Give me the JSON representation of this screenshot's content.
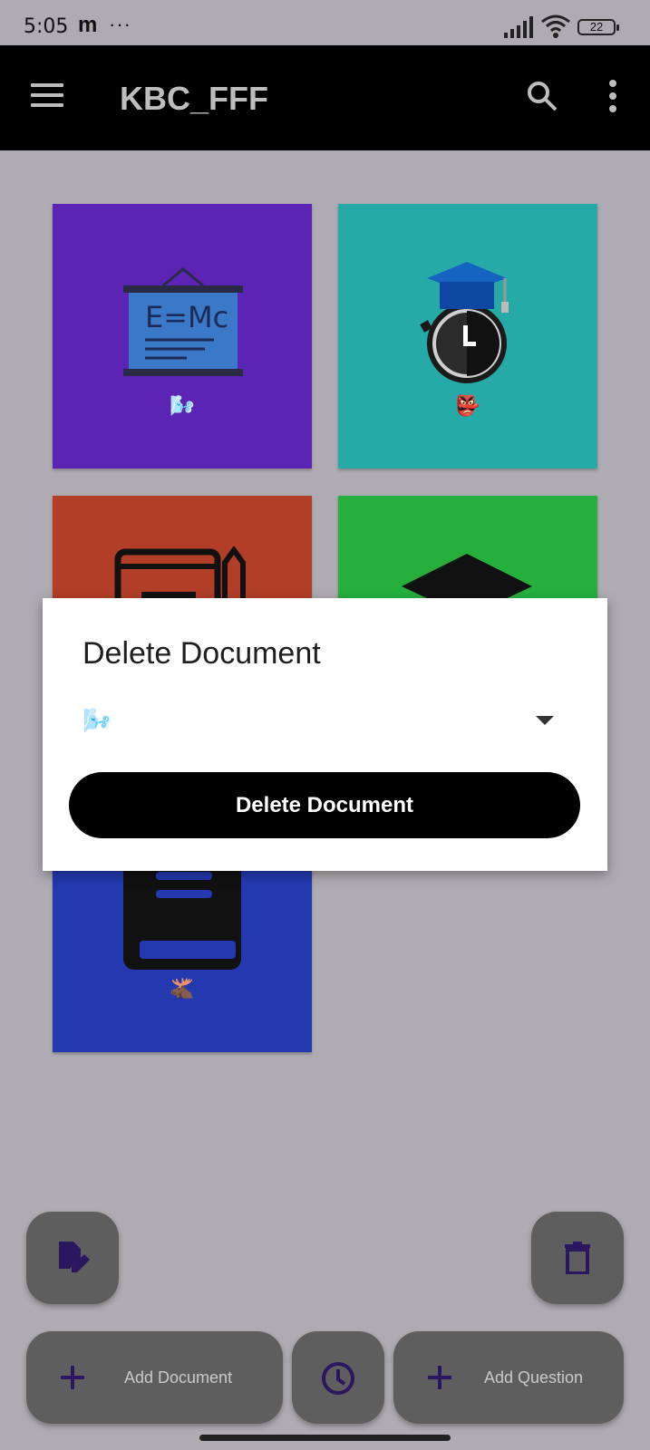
{
  "status_bar": {
    "time": "5:05",
    "carrier_glyph": "m",
    "more": "···",
    "battery": "22"
  },
  "appbar": {
    "title": "KBC_FFF"
  },
  "tiles": [
    {
      "color": "#5b24b5",
      "icon": "physics-board-icon",
      "emoji": "🌬️"
    },
    {
      "color": "#26aaa7",
      "icon": "graduation-timer-icon",
      "emoji": "👺"
    },
    {
      "color": "#b23e27",
      "icon": "notebook-pencil-icon",
      "emoji": ""
    },
    {
      "color": "#25b03e",
      "icon": "graduation-cap-icon",
      "emoji": ""
    },
    {
      "color": "#2439b0",
      "icon": "book-icon",
      "emoji": "🫎"
    }
  ],
  "dialog": {
    "title": "Delete Document",
    "selected_value": "🌬️",
    "button_label": "Delete Document"
  },
  "fabs": {
    "edit_icon": "edit-document-icon",
    "delete_icon": "trash-icon",
    "add_document_label": "Add Document",
    "history_icon": "clock-icon",
    "add_question_label": "Add Question"
  },
  "colors": {
    "icon_accent": "#2b1660",
    "fab_bg": "#5e5e5e",
    "scrim": "#afabb2"
  }
}
